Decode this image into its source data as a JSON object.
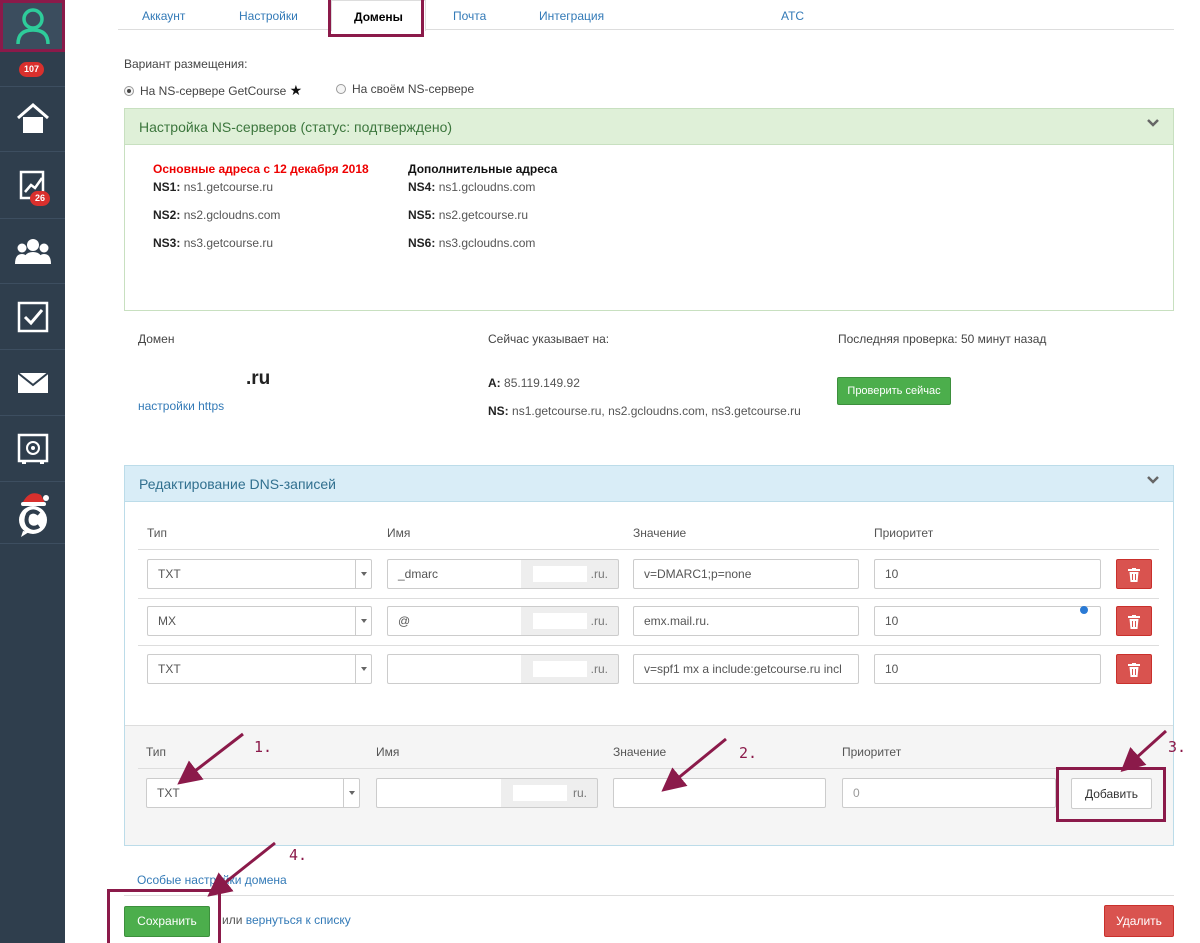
{
  "sidebar": {
    "badges": {
      "profile": "107",
      "stats": "26"
    },
    "icons": [
      "user-icon",
      "home-icon",
      "chart-icon",
      "group-icon",
      "checkbox-icon",
      "mail-icon",
      "safe-icon",
      "chat-santa-icon"
    ]
  },
  "tabs": [
    {
      "label": "Аккаунт"
    },
    {
      "label": "Настройки"
    },
    {
      "label": "Домены"
    },
    {
      "label": "Почта"
    },
    {
      "label": "Интеграция"
    },
    {
      "label": "АТС"
    }
  ],
  "placement": {
    "label": "Вариант размещения:",
    "opt1": "На NS-сервере GetCourse",
    "opt2": "На своём NS-сервере",
    "star": "★"
  },
  "ns_panel": {
    "title": "Настройка NS-серверов (статус: подтверждено)",
    "main_heading": "Основные адреса с 12 декабря 2018",
    "extra_heading": "Дополнительные адреса",
    "main": [
      {
        "key": "NS1:",
        "value": "ns1.getcourse.ru"
      },
      {
        "key": "NS2:",
        "value": "ns2.gcloudns.com"
      },
      {
        "key": "NS3:",
        "value": "ns3.getcourse.ru"
      }
    ],
    "extra": [
      {
        "key": "NS4:",
        "value": "ns1.gcloudns.com"
      },
      {
        "key": "NS5:",
        "value": "ns2.getcourse.ru"
      },
      {
        "key": "NS6:",
        "value": "ns3.gcloudns.com"
      }
    ]
  },
  "domain_info": {
    "domain_label": "Домен",
    "domain_value": ".ru",
    "https_link": "настройки https",
    "points_label": "Сейчас указывает на:",
    "a_key": "A:",
    "a_value": "85.119.149.92",
    "ns_key": "NS:",
    "ns_value": "ns1.getcourse.ru, ns2.gcloudns.com, ns3.getcourse.ru",
    "last_check": "Последняя проверка: 50 минут назад",
    "check_button": "Проверить сейчас"
  },
  "dns_panel": {
    "title": "Редактирование DNS-записей",
    "headers": {
      "type": "Тип",
      "name": "Имя",
      "value": "Значение",
      "priority": "Приоритет"
    },
    "suffix": ".ru.",
    "records": [
      {
        "type": "TXT",
        "name": "_dmarc",
        "value": "v=DMARC1;p=none",
        "priority": "10"
      },
      {
        "type": "MX",
        "name": "@",
        "value": "emx.mail.ru.",
        "priority": "10"
      },
      {
        "type": "TXT",
        "name": "",
        "value": "v=spf1 mx a include:getcourse.ru incl",
        "priority": "10"
      }
    ],
    "new": {
      "headers": {
        "type": "Тип",
        "name": "Имя",
        "value": "Значение",
        "priority": "Приоритет"
      },
      "type": "TXT",
      "suffix": "ru.",
      "priority_placeholder": "0",
      "add_button": "Добавить"
    }
  },
  "annotations": [
    "1.",
    "2.",
    "3.",
    "4."
  ],
  "footer": {
    "special_link": "Особые настройки домена",
    "save": "Сохранить",
    "or": "или",
    "back_link": "вернуться к списку",
    "delete": "Удалить"
  },
  "colors": {
    "sidebar": "#2f3e4d",
    "accent_green": "#4cae4c",
    "danger": "#d9534f",
    "annotation": "#8b1a4a",
    "ns_panel_head": "#dff0d8",
    "dns_panel_head": "#d9edf7"
  }
}
